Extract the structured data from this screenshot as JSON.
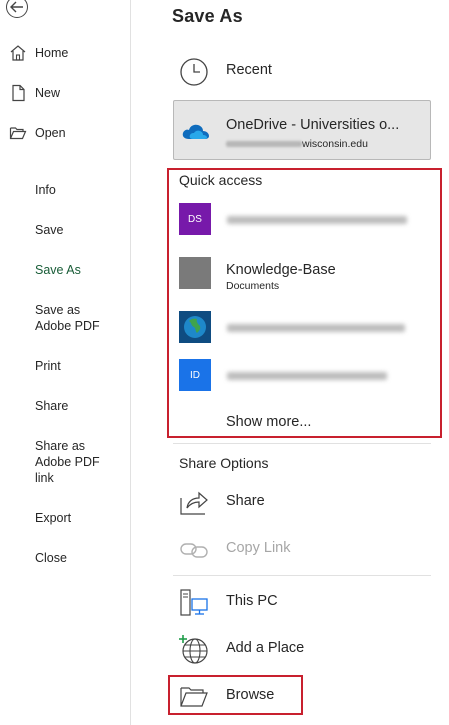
{
  "nav": {
    "top_items": [
      {
        "label": "Home",
        "icon": "home-icon"
      },
      {
        "label": "New",
        "icon": "new-document-icon"
      },
      {
        "label": "Open",
        "icon": "open-folder-icon"
      }
    ],
    "items": [
      {
        "label": "Info"
      },
      {
        "label": "Save"
      },
      {
        "label": "Save As",
        "active": true
      },
      {
        "label": "Save as Adobe PDF"
      },
      {
        "label": "Print"
      },
      {
        "label": "Share"
      },
      {
        "label": "Share as Adobe PDF link"
      },
      {
        "label": "Export"
      },
      {
        "label": "Close"
      }
    ],
    "active_color": "#185c37"
  },
  "page": {
    "title": "Save As"
  },
  "locations": {
    "recent": "Recent",
    "onedrive": {
      "name": "OneDrive - Universities o...",
      "account_visible": "wisconsin.edu"
    }
  },
  "quick_access": {
    "title": "Quick access",
    "items": [
      {
        "badge": "DS",
        "badge_color": "#7719aa",
        "blurred": true
      },
      {
        "name": "Knowledge-Base",
        "sub": "Documents",
        "badge_color": "#7a7a7a",
        "blurred": false
      },
      {
        "badge_color": "#0f4c81",
        "icon": "globe-site-icon",
        "blurred": true
      },
      {
        "badge": "ID",
        "badge_color": "#1a73e8",
        "blurred": true
      }
    ],
    "show_more": "Show more..."
  },
  "share_options": {
    "title": "Share Options",
    "share": "Share",
    "copy_link": "Copy Link"
  },
  "other_locations": {
    "this_pc": "This PC",
    "add_place": "Add a Place",
    "browse": "Browse"
  },
  "colors": {
    "highlight_border": "#c8202e",
    "onedrive_bg": "#e6e6e6"
  }
}
